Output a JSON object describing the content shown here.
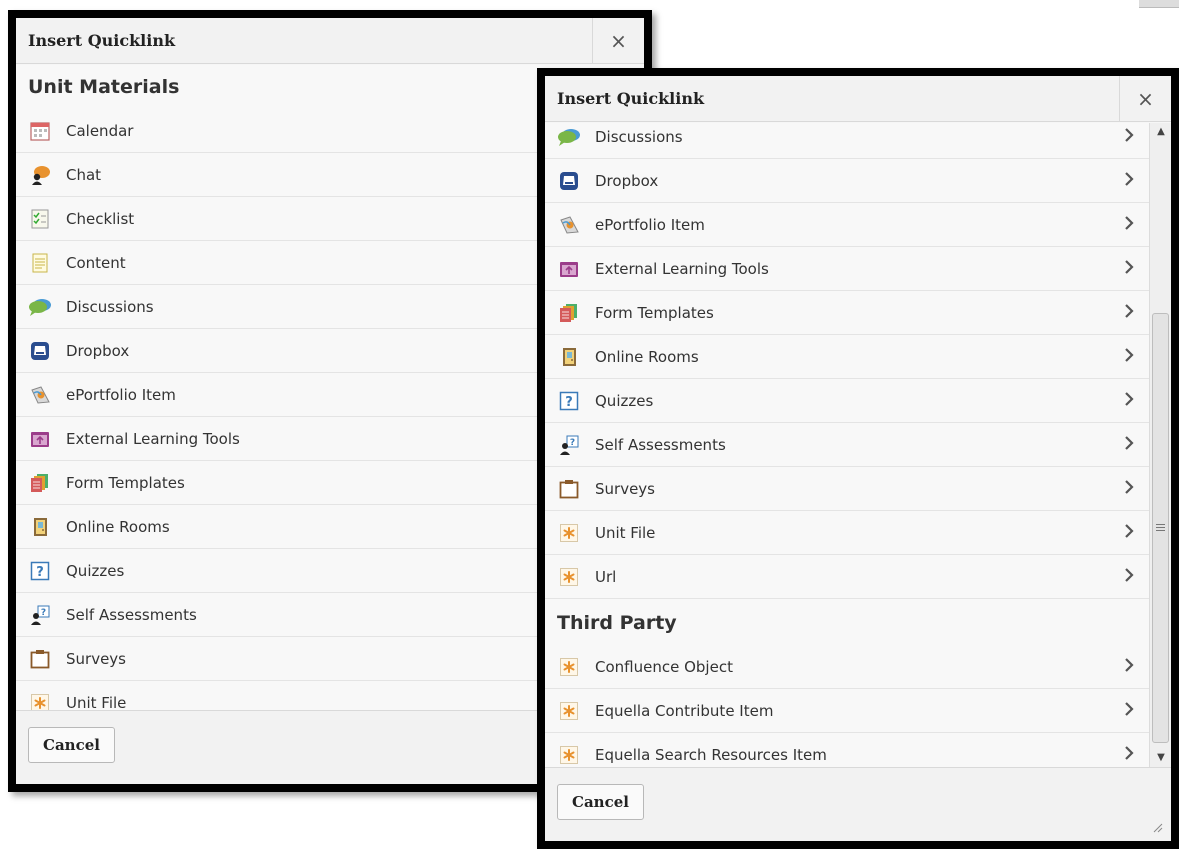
{
  "left_dialog": {
    "title": "Insert Quicklink",
    "close_label": "×",
    "section_title": "Unit Materials",
    "items": [
      {
        "label": "Calendar",
        "icon": "calendar-icon"
      },
      {
        "label": "Chat",
        "icon": "chat-icon"
      },
      {
        "label": "Checklist",
        "icon": "checklist-icon"
      },
      {
        "label": "Content",
        "icon": "content-icon"
      },
      {
        "label": "Discussions",
        "icon": "discussions-icon"
      },
      {
        "label": "Dropbox",
        "icon": "dropbox-icon"
      },
      {
        "label": "ePortfolio Item",
        "icon": "eportfolio-icon"
      },
      {
        "label": "External Learning Tools",
        "icon": "external-tools-icon"
      },
      {
        "label": "Form Templates",
        "icon": "form-templates-icon"
      },
      {
        "label": "Online Rooms",
        "icon": "online-rooms-icon"
      },
      {
        "label": "Quizzes",
        "icon": "quizzes-icon"
      },
      {
        "label": "Self Assessments",
        "icon": "self-assessment-icon"
      },
      {
        "label": "Surveys",
        "icon": "surveys-icon"
      },
      {
        "label": "Unit File",
        "icon": "file-icon"
      }
    ],
    "cancel_label": "Cancel"
  },
  "right_dialog": {
    "title": "Insert Quicklink",
    "close_label": "×",
    "items_top": [
      {
        "label": "Discussions",
        "icon": "discussions-icon"
      },
      {
        "label": "Dropbox",
        "icon": "dropbox-icon"
      },
      {
        "label": "ePortfolio Item",
        "icon": "eportfolio-icon"
      },
      {
        "label": "External Learning Tools",
        "icon": "external-tools-icon"
      },
      {
        "label": "Form Templates",
        "icon": "form-templates-icon"
      },
      {
        "label": "Online Rooms",
        "icon": "online-rooms-icon"
      },
      {
        "label": "Quizzes",
        "icon": "quizzes-icon"
      },
      {
        "label": "Self Assessments",
        "icon": "self-assessment-icon"
      },
      {
        "label": "Surveys",
        "icon": "surveys-icon"
      },
      {
        "label": "Unit File",
        "icon": "file-icon"
      },
      {
        "label": "Url",
        "icon": "url-icon"
      }
    ],
    "section_title": "Third Party",
    "items_bottom": [
      {
        "label": "Confluence Object",
        "icon": "file-icon"
      },
      {
        "label": "Equella Contribute Item",
        "icon": "file-icon"
      },
      {
        "label": "Equella Search Resources Item",
        "icon": "file-icon"
      }
    ],
    "cancel_label": "Cancel"
  },
  "colors": {
    "frame": "#000000",
    "header_bg": "#f2f2f2",
    "body_bg": "#f8f8f8",
    "divider": "#e4e4e4",
    "text": "#333333"
  }
}
